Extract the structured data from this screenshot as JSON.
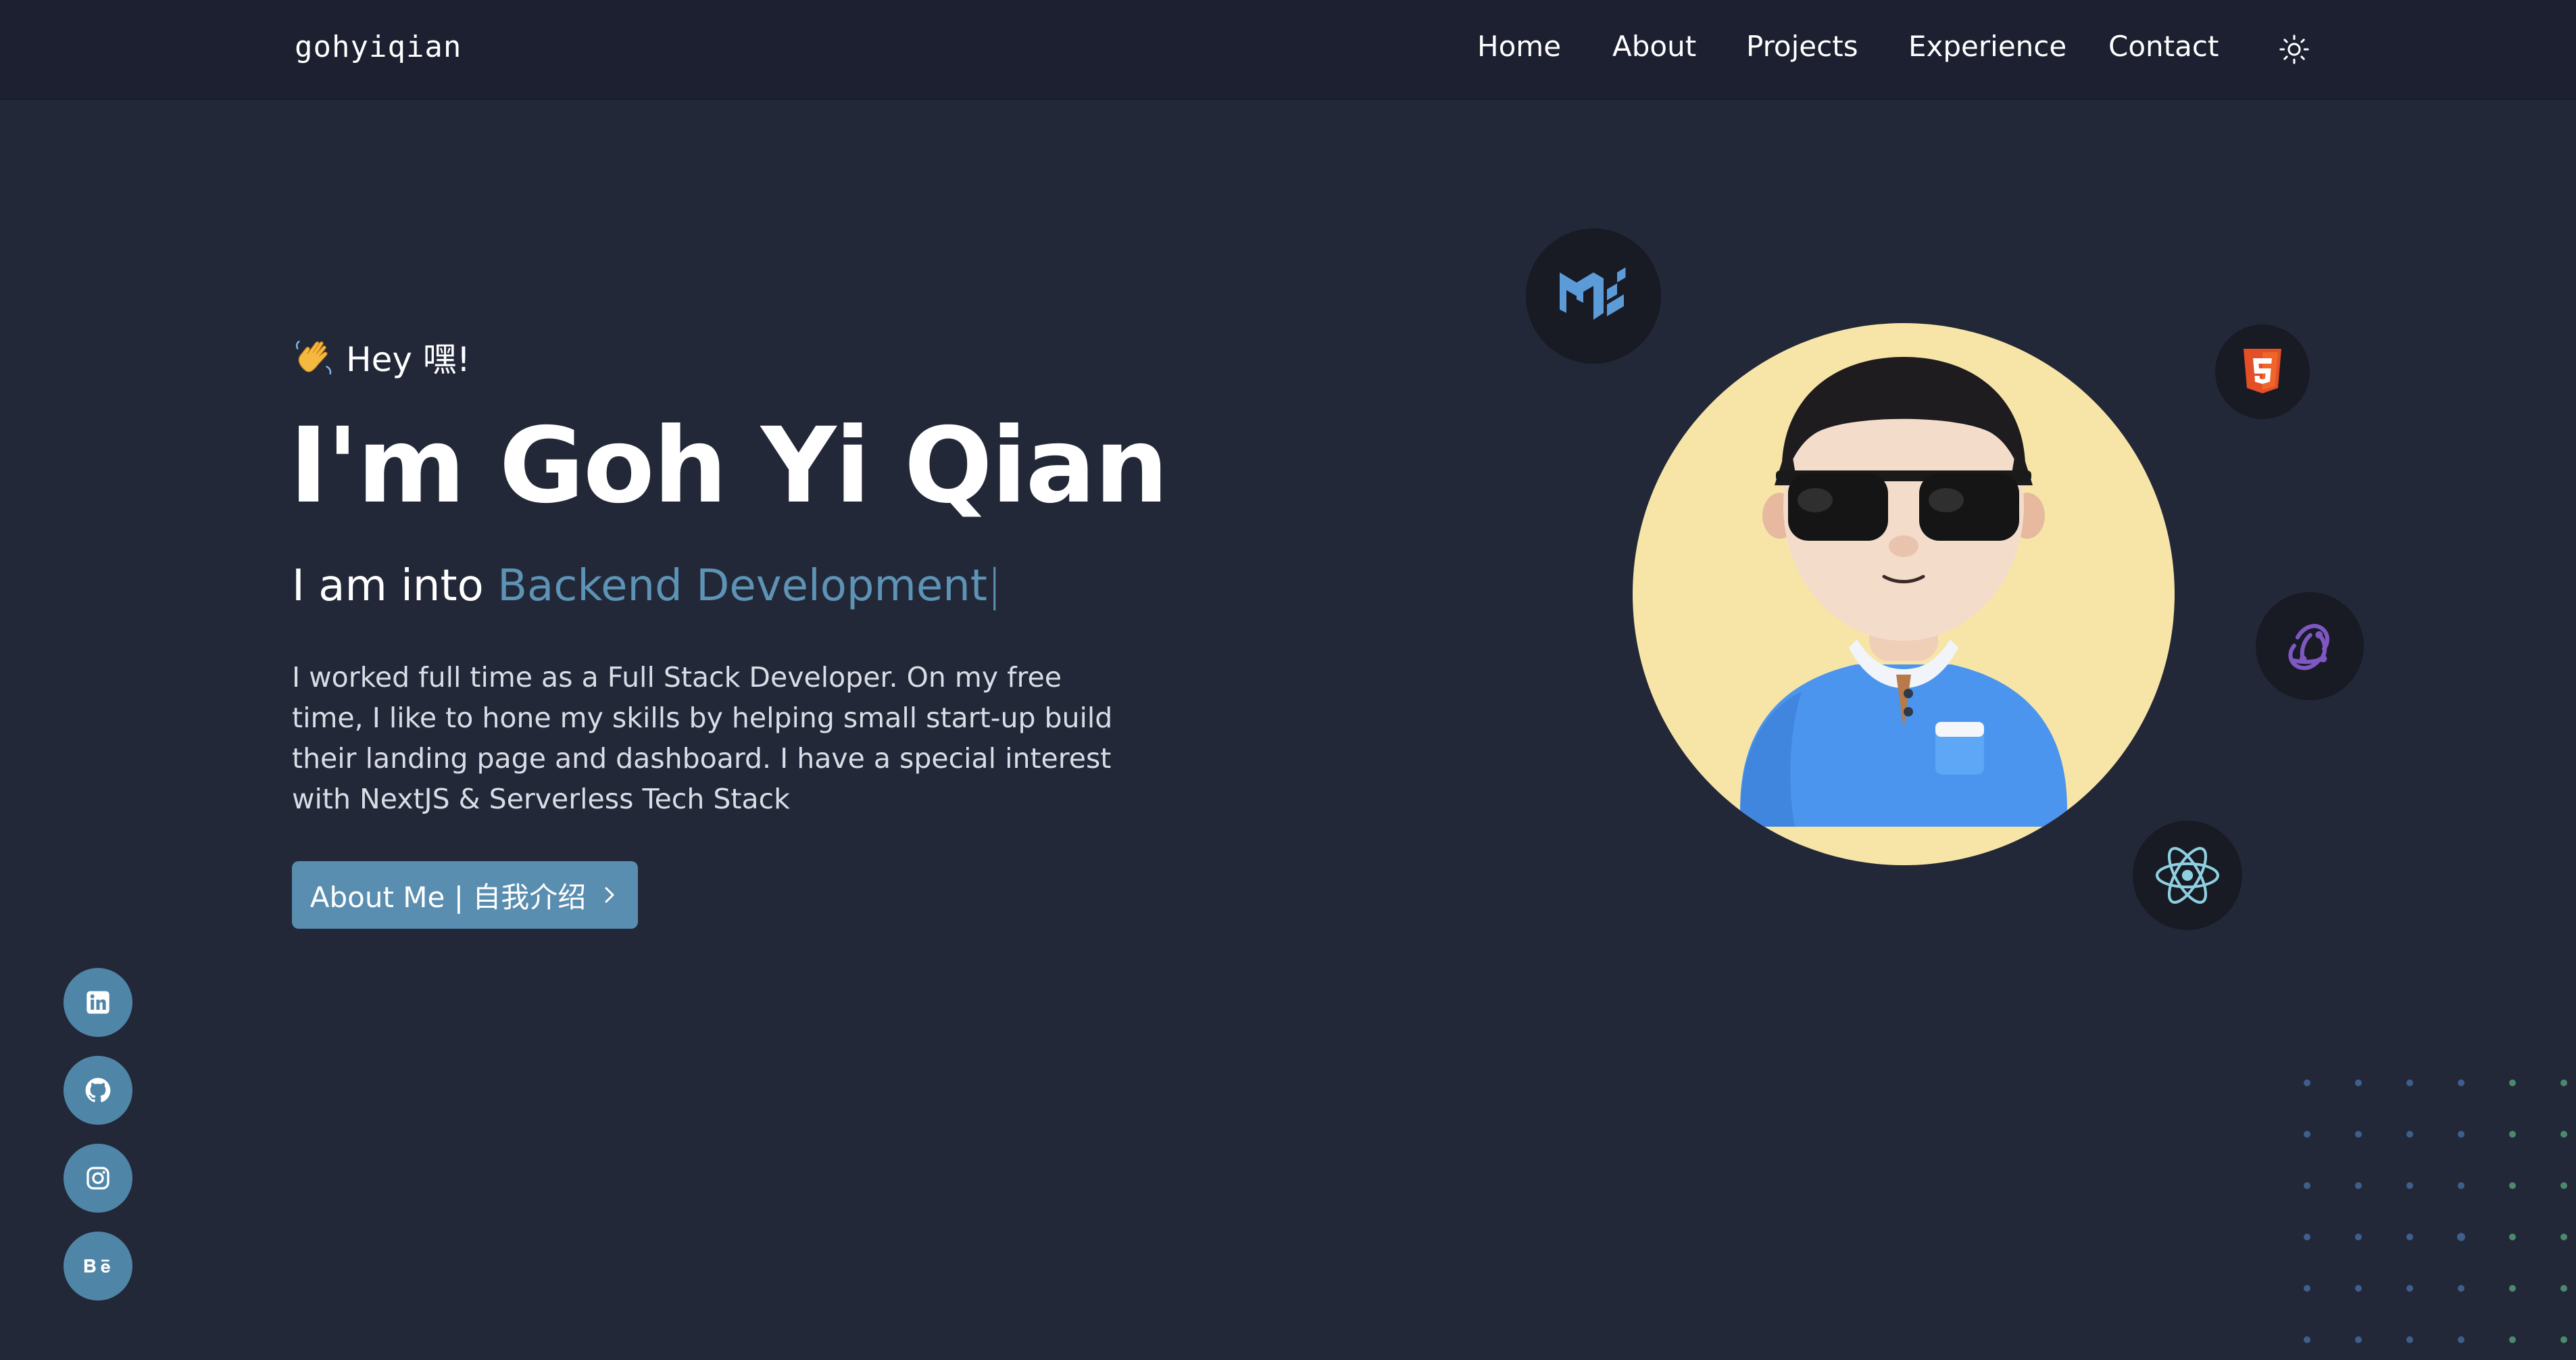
{
  "header": {
    "brand": "gohyiqian",
    "nav": [
      "Home",
      "About",
      "Projects",
      "Experience",
      "Contact"
    ],
    "theme_icon": "sun-icon"
  },
  "hero": {
    "greeting": "Hey 嘿!",
    "greeting_icon": "waving-hand-icon",
    "title": "I'm Goh Yi Qian",
    "tagline_prefix": "I am into ",
    "tagline_role": "Backend Development",
    "tagline_caret": "|",
    "intro": "I worked full time as a Full Stack Developer. On my free time, I like to hone my skills by helping small start-up build their landing page and dashboard. I have a special interest with NextJS & Serverless Tech Stack",
    "cta_label": "About Me | 自我介绍",
    "cta_icon": "chevron-right-icon"
  },
  "social": [
    "linkedin-icon",
    "github-icon",
    "instagram-icon",
    "behance-icon"
  ],
  "tech_icons": [
    "material-ui-icon",
    "html5-icon",
    "redux-icon",
    "react-icon"
  ],
  "colors": {
    "background": "#232839",
    "navbar": "#1c2030",
    "accent": "#5d93b4",
    "button": "#5a8eb0",
    "avatar_bg": "#f7e5a8"
  }
}
